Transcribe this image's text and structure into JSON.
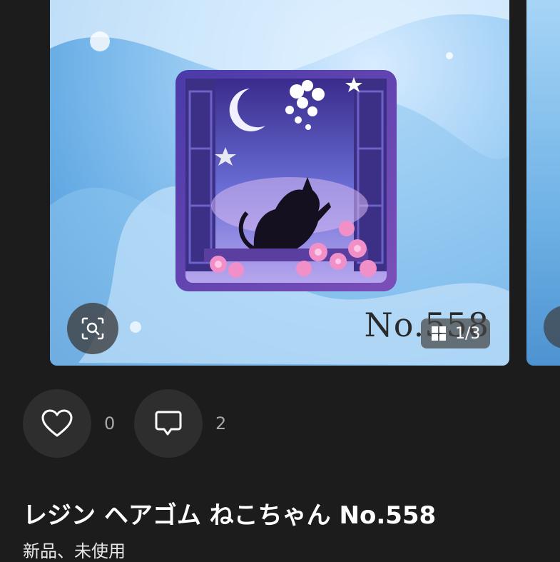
{
  "image": {
    "watermark_text": "No.558",
    "counter_text": "1/3",
    "zoom_icon": "zoom-scan-icon",
    "grid_icon": "grid-icon"
  },
  "actions": {
    "like_icon": "heart-icon",
    "like_count": "0",
    "comment_icon": "comment-icon",
    "comment_count": "2"
  },
  "product": {
    "title": "レジン ヘアゴム ねこちゃん No.558",
    "condition": "新品、未使用"
  },
  "colors": {
    "background": "#1c1c1c",
    "button_bg": "#2e2e2e",
    "count_text": "#a8a8a8"
  }
}
